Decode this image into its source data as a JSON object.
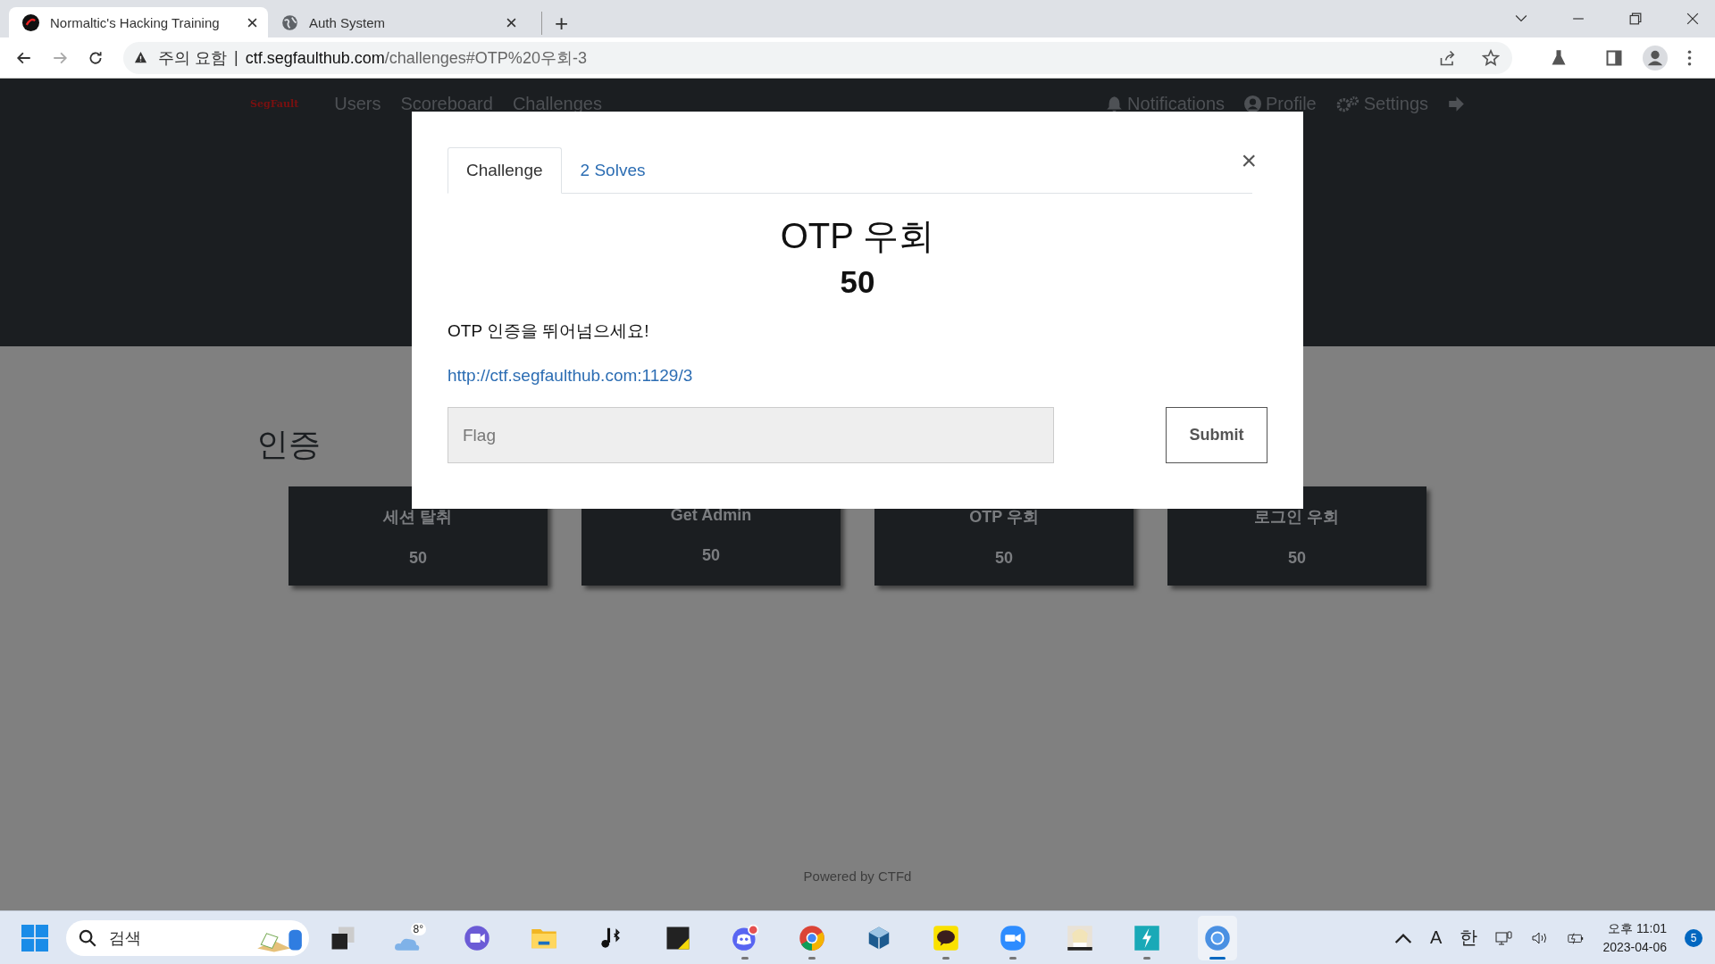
{
  "browser": {
    "tabs": [
      {
        "title": "Normaltic's Hacking Training",
        "selected": true,
        "kind": "sf"
      },
      {
        "title": "Auth System",
        "selected": false,
        "kind": "globe"
      }
    ],
    "new_tab": "+",
    "security_warning": "주의 요함",
    "separator": "|",
    "url_host": "ctf.segfaulthub.com",
    "url_path": "/challenges#OTP%20우회-3"
  },
  "navbar": {
    "brand": "SegFault",
    "links": [
      "Users",
      "Scoreboard",
      "Challenges"
    ],
    "right": [
      {
        "label": "Notifications",
        "kind": "bell"
      },
      {
        "label": "Profile",
        "kind": "user"
      },
      {
        "label": "Settings",
        "kind": "gears"
      },
      {
        "kind": "logout"
      }
    ]
  },
  "category": "인증",
  "challenges": [
    {
      "name": "세션 탈취",
      "value": "50"
    },
    {
      "name": "Get Admin",
      "value": "50"
    },
    {
      "name": "OTP 우회",
      "value": "50"
    },
    {
      "name": "로그인 우회",
      "value": "50"
    }
  ],
  "footer": "Powered by CTFd",
  "modal": {
    "tabs": [
      {
        "label": "Challenge",
        "selected": true
      },
      {
        "label": "2 Solves",
        "selected": false
      }
    ],
    "close": "×",
    "title": "OTP 우회",
    "value": "50",
    "description": "OTP 인증을 뛰어넘으세요!",
    "link": "http://ctf.segfaulthub.com:1129/3",
    "flag": {
      "placeholder": "Flag"
    },
    "submit": "Submit"
  },
  "taskbar": {
    "search": {
      "placeholder": "검색"
    },
    "weather": "8°",
    "apps": [
      {
        "kind": "taskview",
        "running": false,
        "active": false
      },
      {
        "kind": "weather",
        "running": false,
        "active": false
      },
      {
        "kind": "chat",
        "running": false,
        "active": false
      },
      {
        "kind": "folder",
        "running": false,
        "active": false
      },
      {
        "kind": "music",
        "running": false,
        "active": false
      },
      {
        "kind": "notes",
        "running": false,
        "active": false
      },
      {
        "kind": "discord",
        "running": true,
        "active": false
      },
      {
        "kind": "chrome",
        "running": true,
        "active": false
      },
      {
        "kind": "box",
        "running": false,
        "active": false
      },
      {
        "kind": "talk",
        "running": true,
        "active": false
      },
      {
        "kind": "zoom",
        "running": true,
        "active": false
      },
      {
        "kind": "game",
        "running": false,
        "active": false
      },
      {
        "kind": "bolt",
        "running": true,
        "active": false
      },
      {
        "kind": "chromium",
        "running": true,
        "active": true
      }
    ],
    "ime_mode": "A",
    "ime_lang": "한",
    "time": "오후 11:01",
    "date": "2023-04-06",
    "notifications": "5"
  }
}
